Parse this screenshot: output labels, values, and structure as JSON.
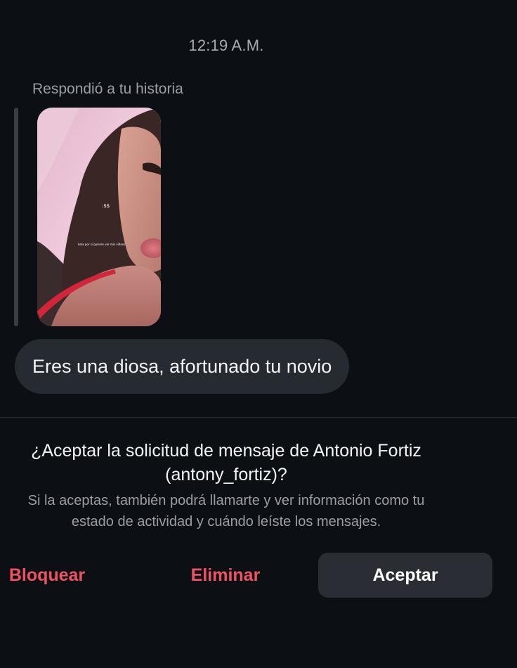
{
  "chat": {
    "timestamp": "12:19 A.M.",
    "story_reply_label": "Respondió a tu historia",
    "story_preview": {
      "overlay_text_1": ":$$",
      "overlay_text_2": "hola por si quieres ver mis videos"
    },
    "message": "Eres una diosa, afortunado tu novio"
  },
  "request": {
    "title_line1": "¿Aceptar la solicitud de mensaje de Antonio Fortiz",
    "title_line2": "(antony_fortiz)?",
    "desc_line1": "Si la aceptas, también podrá llamarte y ver información como tu",
    "desc_line2": "estado de actividad y cuándo leíste los mensajes."
  },
  "actions": {
    "block": "Bloquear",
    "delete": "Eliminar",
    "accept": "Aceptar"
  },
  "colors": {
    "background": "#0c0f14",
    "bubble": "#262a31",
    "destructive": "#ef5363",
    "accept_button": "#2a2d34"
  }
}
